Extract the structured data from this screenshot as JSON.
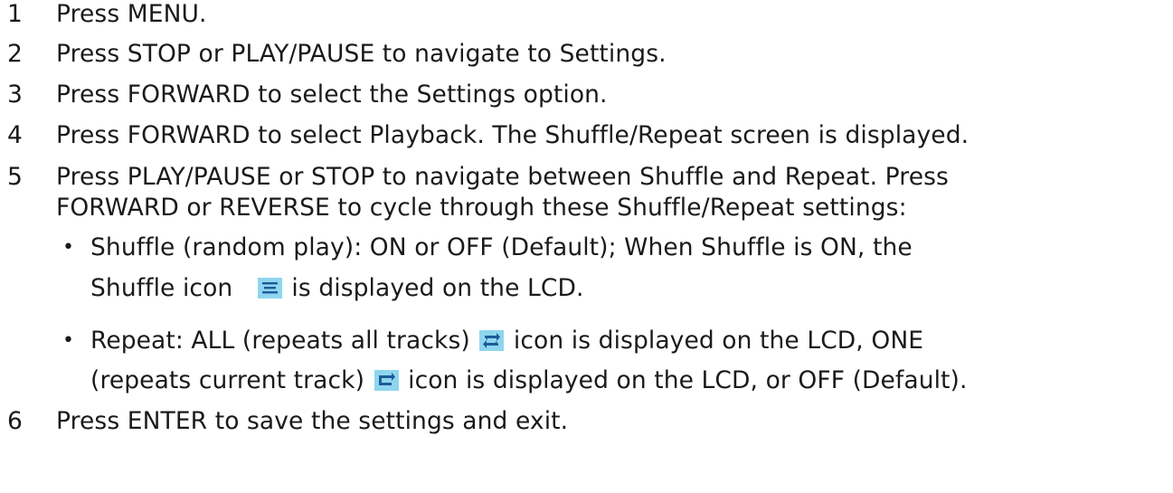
{
  "steps": [
    {
      "num": "1",
      "text": "Press MENU."
    },
    {
      "num": "2",
      "text": "Press STOP or PLAY/PAUSE to navigate to Settings."
    },
    {
      "num": "3",
      "text": "Press FORWARD to select the Settings option."
    },
    {
      "num": "4",
      "text": "Press FORWARD to select Playback. The Shuffle/Repeat screen is displayed."
    },
    {
      "num": "5",
      "text_line1": "Press PLAY/PAUSE or STOP to navigate between Shuffle and Repeat. Press",
      "text_line2": "FORWARD or REVERSE to cycle through these Shuffle/Repeat settings:"
    },
    {
      "num": "6",
      "text": "Press ENTER to save the settings and exit."
    }
  ],
  "bullets": [
    {
      "marker": "•",
      "line1": "Shuffle (random play): ON or OFF (Default); When Shuffle is ON, the",
      "line2_before_icon": "Shuffle icon",
      "line2_after_icon": "is displayed on the LCD.",
      "icon": "shuffle-icon"
    },
    {
      "marker": "•",
      "line1_before_icon": "Repeat: ALL (repeats all tracks)",
      "line1_after_icon": "icon is displayed on the LCD, ONE",
      "line1_icon": "repeat-all-icon",
      "line2_before_icon": "(repeats current track)",
      "line2_after_icon": "icon is displayed on the LCD, or OFF (Default).",
      "line2_icon": "repeat-one-icon"
    }
  ],
  "colors": {
    "text": "#1a1a1a",
    "icon_background": "#8ed6ee",
    "icon_foreground": "#1f5a9a"
  }
}
